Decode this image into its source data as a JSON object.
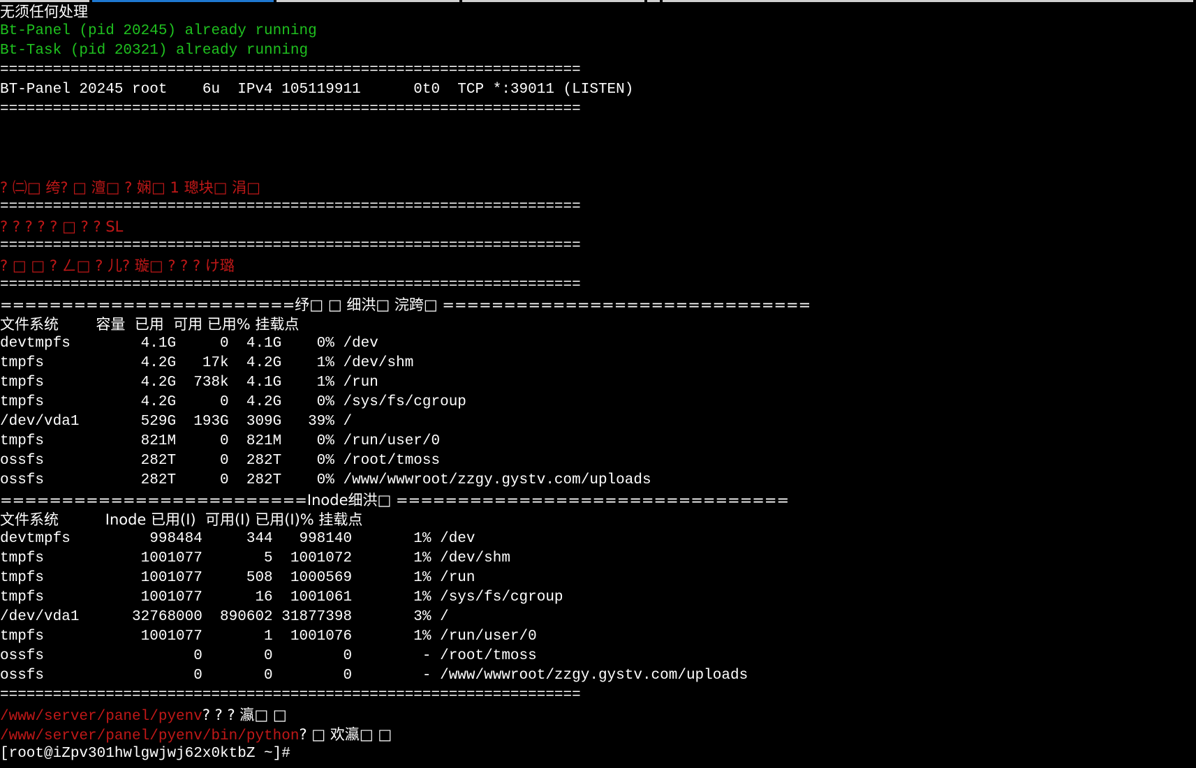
{
  "colors": {
    "background": "#000000",
    "default_text": "#ffffff",
    "green_text": "#1fc01f",
    "red_text": "#c01818",
    "tab_active": "#1e78d0",
    "tab_inactive": "#d0d0d0"
  },
  "lines": {
    "l01": "无须任何处理",
    "l02": "Bt-Panel (pid 20245) already running",
    "l03": "Bt-Task (pid 20321) already running",
    "l04": "==================================================================",
    "l05": "BT-Panel 20245 root    6u  IPv4 105119911      0t0  TCP *:39011 (LISTEN)",
    "l06": "==================================================================",
    "l10": "? ㈡□ 绔? □ 澶□ ? 娴□ 1 璁块□ 涓□",
    "l11": "==================================================================",
    "l12": "? ? ? ? ? □ ? ? SL",
    "l13": "==================================================================",
    "l14": "? □ □ ? ㄥ□ ? 儿? 璇□ ? ? ? け璐",
    "l15": "==================================================================",
    "l16": "========================纾□ □ 细洪□ 浣跨□ ==============================",
    "fs_header": "文件系统        容量  已用  可用 已用% 挂载点",
    "fs_rows": [
      "devtmpfs        4.1G     0  4.1G    0% /dev",
      "tmpfs           4.2G   17k  4.2G    1% /dev/shm",
      "tmpfs           4.2G  738k  4.1G    1% /run",
      "tmpfs           4.2G     0  4.2G    0% /sys/fs/cgroup",
      "/dev/vda1       529G  193G  309G   39% /",
      "tmpfs           821M     0  821M    0% /run/user/0",
      "ossfs           282T     0  282T    0% /root/tmoss",
      "ossfs           282T     0  282T    0% /www/wwwroot/zzgy.gystv.com/uploads"
    ],
    "inode_sep": "=========================Inode细洪□ ================================",
    "inode_header": "文件系统          Inode 已用(I)  可用(I) 已用(I)% 挂载点",
    "inode_rows": [
      "devtmpfs         998484     344   998140       1% /dev",
      "tmpfs           1001077       5  1001072       1% /dev/shm",
      "tmpfs           1001077     508  1000569       1% /run",
      "tmpfs           1001077      16  1001061       1% /sys/fs/cgroup",
      "/dev/vda1      32768000  890602 31877398       3% /",
      "tmpfs           1001077       1  1001076       1% /run/user/0",
      "ossfs                 0       0        0        - /root/tmoss",
      "ossfs                 0       0        0        - /www/wwwroot/zzgy.gystv.com/uploads"
    ],
    "end_sep": "==================================================================",
    "pyenv_path": "/www/server/panel/pyenv",
    "pyenv_suffix": "? ? ? 瀛□ □",
    "python_path": "/www/server/panel/pyenv/bin/python",
    "python_suffix": "? □ 欢瀛□ □",
    "prompt": "[root@iZpv301hwlgwjwj62x0ktbZ ~]#"
  }
}
